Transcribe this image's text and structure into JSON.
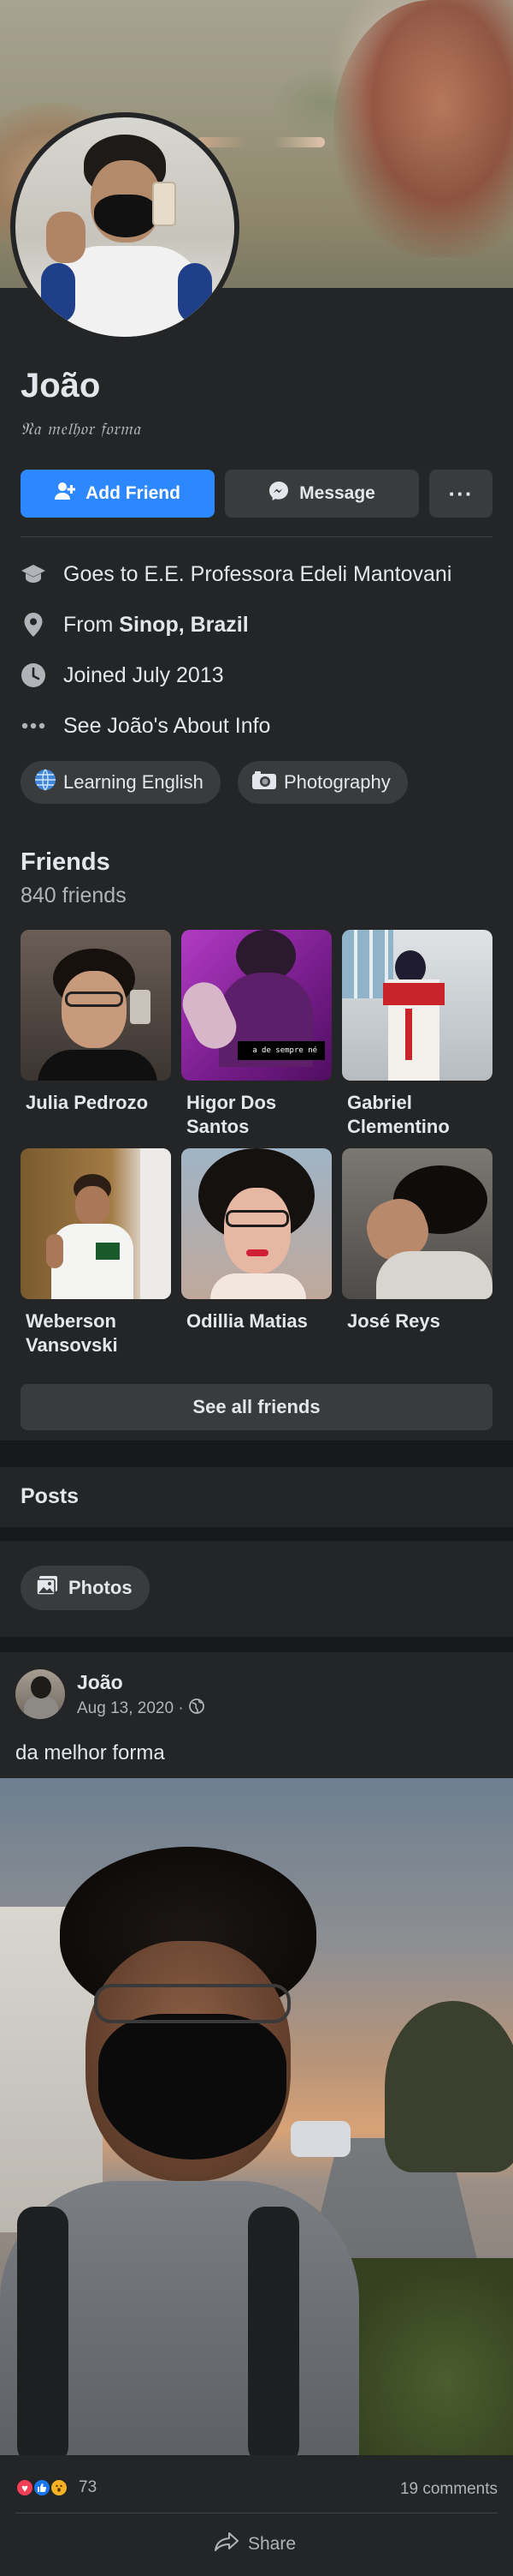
{
  "profile": {
    "name": "João",
    "tagline": "𝔑𝔞 𝔪𝔢𝔩𝔥𝔬𝔯 𝔣𝔬𝔯𝔪𝔞",
    "actions": {
      "add_friend": "Add Friend",
      "message": "Message",
      "more": "···"
    },
    "info": {
      "school": "Goes to E.E. Professora Edeli Mantovani",
      "from_prefix": "From ",
      "from_place": "Sinop, Brazil",
      "joined": "Joined July 2013",
      "about": "See João's About Info"
    },
    "interests": [
      "Learning English",
      "Photography"
    ]
  },
  "friends": {
    "title": "Friends",
    "count": "840 friends",
    "items": [
      {
        "name": "Julia Pedrozo"
      },
      {
        "name": "Higor Dos Santos"
      },
      {
        "name": "Gabriel Clementino"
      },
      {
        "name": "Weberson Vansovski"
      },
      {
        "name": "Odillia Matias"
      },
      {
        "name": "José Reys"
      }
    ],
    "see_all": "See all friends",
    "photo_caption": "ㅤa de sempre né"
  },
  "posts": {
    "title": "Posts",
    "photos_label": "Photos"
  },
  "post": {
    "author": "João",
    "date": "Aug 13, 2020 ·",
    "text": "da melhor forma",
    "reaction_count": "73",
    "comments": "19 comments",
    "share": "Share"
  },
  "colors": {
    "background": "#18191a",
    "card": "#242526",
    "button": "#3a3b3c",
    "accent": "#2d88ff",
    "text": "#e4e6eb",
    "secondary_text": "#b0b3b8"
  },
  "icons": {
    "add_friend": "person-plus-icon",
    "message": "messenger-icon",
    "school": "graduation-cap-icon",
    "from": "location-pin-icon",
    "joined": "clock-icon",
    "about": "ellipsis-icon",
    "learning_english": "globe-icon",
    "photography": "camera-icon",
    "photos": "image-icon",
    "privacy": "globe-icon",
    "share": "share-arrow-icon",
    "reactions": [
      "love-icon",
      "like-icon",
      "wow-icon"
    ]
  }
}
